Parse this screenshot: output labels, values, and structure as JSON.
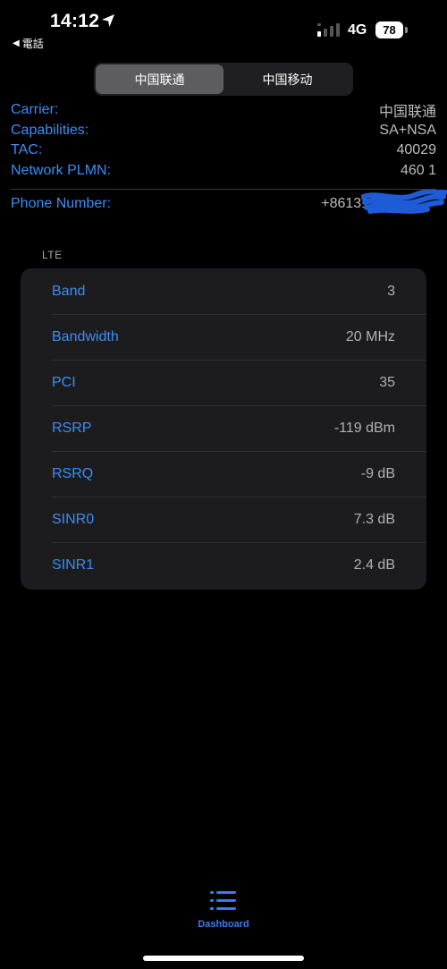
{
  "status_bar": {
    "time": "14:12",
    "back_label": "電話",
    "network": "4G",
    "battery": "78"
  },
  "segments": [
    {
      "label": "中国联通",
      "active": true
    },
    {
      "label": "中国移动",
      "active": false
    }
  ],
  "info": {
    "carrier_label": "Carrier:",
    "carrier_value": "中国联通",
    "capabilities_label": "Capabilities:",
    "capabilities_value": "SA+NSA",
    "tac_label": "TAC:",
    "tac_value": "40029",
    "plmn_label": "Network PLMN:",
    "plmn_value": "460 1",
    "phone_label": "Phone Number:",
    "phone_value": "+861313"
  },
  "lte": {
    "header": "LTE",
    "rows": [
      {
        "label": "Band",
        "value": "3"
      },
      {
        "label": "Bandwidth",
        "value": "20 MHz"
      },
      {
        "label": "PCI",
        "value": "35"
      },
      {
        "label": "RSRP",
        "value": "-119 dBm"
      },
      {
        "label": "RSRQ",
        "value": "-9 dB"
      },
      {
        "label": "SINR0",
        "value": "7.3 dB"
      },
      {
        "label": "SINR1",
        "value": "2.4 dB"
      }
    ]
  },
  "tab_bar": {
    "dashboard_label": "Dashboard"
  },
  "colors": {
    "accent": "#3a8ef6",
    "card_bg": "#1c1c1e",
    "redaction": "#1e5bd6"
  },
  "icons": {
    "location": "location-arrow-icon",
    "back": "back-triangle-icon",
    "signal": "signal-bars-icon",
    "battery": "battery-icon",
    "tab": "list-icon"
  }
}
